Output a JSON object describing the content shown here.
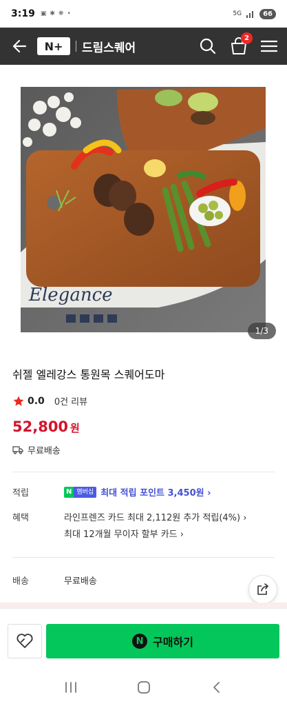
{
  "status_bar": {
    "time": "3:19",
    "left_icons": [
      "gallery-icon",
      "fan-icon",
      "settings-icon",
      "dot-icon"
    ],
    "battery": "66",
    "network": "5G"
  },
  "header": {
    "logo_text": "N+",
    "store_name": "드림스퀘어",
    "cart_count": "2",
    "icons": [
      "back-arrow-icon",
      "search-icon",
      "cart-icon",
      "menu-icon"
    ]
  },
  "gallery": {
    "watermark_text": "Elegance",
    "counter": "1/3"
  },
  "product": {
    "title": "쉬젤 엘레강스 통원목 스퀘어도마",
    "rating": "0.0",
    "review_count": "0건 리뷰",
    "price": "52,800",
    "currency": "원",
    "shipping": "무료배송"
  },
  "details": {
    "points_label": "적립",
    "membership_n": "N",
    "membership_badge": "멤버십",
    "points_text": "최대 적립 포인트 3,450원",
    "benefit_label": "혜택",
    "benefit_line1": "라인프렌즈 카드 최대 2,112원 추가 적립(4%)",
    "benefit_line2": "최대 12개월 무이자 할부 카드",
    "delivery_label": "배송",
    "delivery_value": "무료배송"
  },
  "actions": {
    "buy_button_label": "구매하기",
    "buy_icon_letter": "N"
  },
  "colors": {
    "header_bg": "#333333",
    "price_red": "#d3142b",
    "naver_green": "#03c75a",
    "points_blue": "#4451d4",
    "star_red": "#e8291c",
    "badge_red": "#f02828"
  }
}
